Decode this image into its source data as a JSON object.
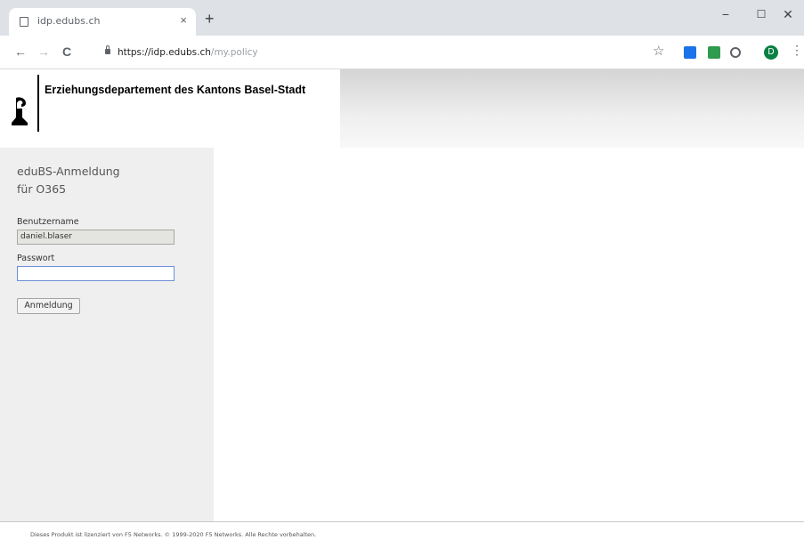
{
  "browser": {
    "tab_title": "idp.edubs.ch",
    "tab_close": "×",
    "new_tab": "+",
    "window": {
      "minimize": "−",
      "maximize": "☐",
      "close": "✕"
    },
    "nav": {
      "back": "←",
      "forward": "→",
      "reload": "C"
    },
    "url_host": "https://idp.edubs.ch",
    "url_path": "/my.policy",
    "bookmark_star": "☆",
    "profile_initial": "D",
    "menu": "⋮"
  },
  "banner": {
    "org_name": "Erziehungsdepartement des Kantons Basel-Stadt"
  },
  "login": {
    "title_line1": "eduBS-Anmeldung",
    "title_line2": "für O365",
    "username_label": "Benutzername",
    "username_value": "daniel.blaser",
    "password_label": "Passwort",
    "password_value": "",
    "submit_label": "Anmeldung"
  },
  "footer": {
    "text": "Dieses Produkt ist lizenziert von F5 Networks. © 1999-2020 F5 Networks. Alle Rechte vorbehalten."
  }
}
